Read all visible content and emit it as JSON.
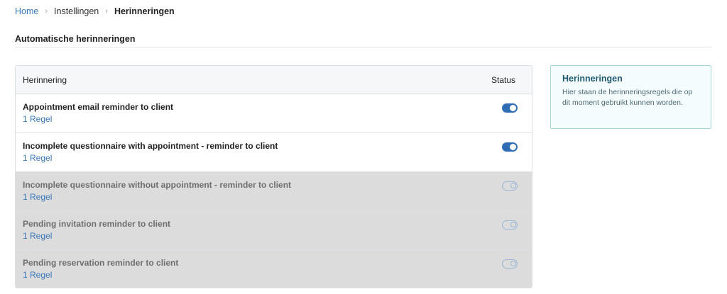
{
  "breadcrumb": {
    "home": "Home",
    "settings": "Instellingen",
    "current": "Herinneringen",
    "separator": "›"
  },
  "section": {
    "title": "Automatische herinneringen"
  },
  "table": {
    "headers": {
      "name": "Herinnering",
      "status": "Status"
    },
    "rows": [
      {
        "title": "Appointment email reminder to client",
        "rules": "1 Regel",
        "enabled": true
      },
      {
        "title": "Incomplete questionnaire with appointment - reminder to client",
        "rules": "1 Regel",
        "enabled": true
      },
      {
        "title": "Incomplete questionnaire without appointment - reminder to client",
        "rules": "1 Regel",
        "enabled": false
      },
      {
        "title": "Pending invitation reminder to client",
        "rules": "1 Regel",
        "enabled": false
      },
      {
        "title": "Pending reservation reminder to client",
        "rules": "1 Regel",
        "enabled": false
      }
    ]
  },
  "info": {
    "title": "Herinneringen",
    "body": "Hier staan de herinneringsregels die op dit moment gebruikt kunnen worden."
  },
  "colors": {
    "link": "#3a78b8",
    "toggle_on": "#2e6db4",
    "toggle_off": "#9cb6d3",
    "inactive_row": "#dcdcdd",
    "info_border": "#a9d4de"
  }
}
